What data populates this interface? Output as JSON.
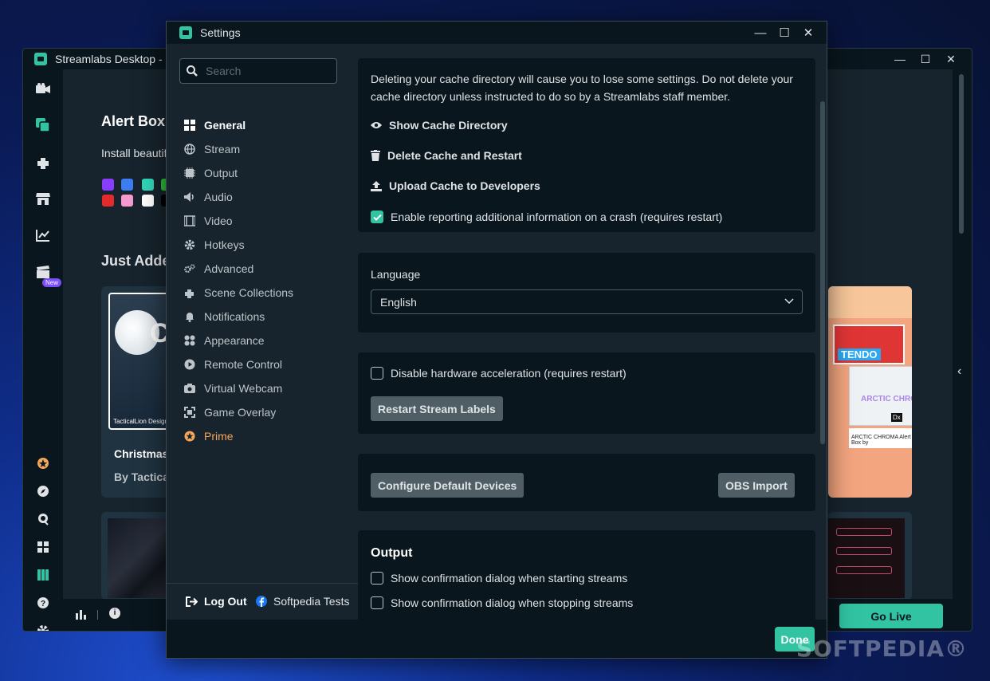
{
  "main_window": {
    "title": "Streamlabs Desktop - ",
    "new_badge": "New",
    "alert_box_title": "Alert Box",
    "alert_box_desc": "Install beautif",
    "swatches": [
      "#8b3dff",
      "#3d7df2",
      "#30d6b8",
      "#2ec43b",
      "#e32b2b",
      "#f59ad0",
      "#ffffff",
      "#000000"
    ],
    "just_added": "Just Adde",
    "card_left": {
      "name": "Christmas",
      "by": "By Tactical",
      "brand": "TacticalLion Designs",
      "letters": "CH"
    },
    "card_right": {
      "tendo": "TENDO",
      "arctic": "ARCTIC CHRO",
      "caption": "ARCTIC CHROMA Alert Box by",
      "badge": "Dx"
    },
    "go_live": "Go Live",
    "footer_info": "i"
  },
  "settings": {
    "title": "Settings",
    "search_placeholder": "Search",
    "nav": [
      {
        "label": "General",
        "icon": "grid-icon"
      },
      {
        "label": "Stream",
        "icon": "globe-icon"
      },
      {
        "label": "Output",
        "icon": "chip-icon"
      },
      {
        "label": "Audio",
        "icon": "speaker-icon"
      },
      {
        "label": "Video",
        "icon": "film-icon"
      },
      {
        "label": "Hotkeys",
        "icon": "gear-icon"
      },
      {
        "label": "Advanced",
        "icon": "gears-icon"
      },
      {
        "label": "Scene Collections",
        "icon": "puzzle-icon"
      },
      {
        "label": "Notifications",
        "icon": "bell-icon"
      },
      {
        "label": "Appearance",
        "icon": "apps-icon"
      },
      {
        "label": "Remote Control",
        "icon": "play-circle-icon"
      },
      {
        "label": "Virtual Webcam",
        "icon": "camera-icon"
      },
      {
        "label": "Game Overlay",
        "icon": "expand-icon"
      },
      {
        "label": "Prime",
        "icon": "prime-icon"
      }
    ],
    "logout": "Log Out",
    "account": "Softpedia Tests",
    "cache": {
      "warning": "Deleting your cache directory will cause you to lose some settings. Do not delete your cache directory unless instructed to do so by a Streamlabs staff member.",
      "show": "Show Cache Directory",
      "delete": "Delete Cache and Restart",
      "upload": "Upload Cache to Developers",
      "reporting": "Enable reporting additional information on a crash (requires restart)"
    },
    "language": {
      "label": "Language",
      "value": "English"
    },
    "hardware": {
      "disable_accel": "Disable hardware acceleration (requires restart)",
      "restart_labels": "Restart Stream Labels"
    },
    "devices": {
      "configure": "Configure Default Devices",
      "obs_import": "OBS Import"
    },
    "output": {
      "title": "Output",
      "confirm_start": "Show confirmation dialog when starting streams",
      "confirm_stop": "Show confirmation dialog when stopping streams"
    },
    "done": "Done"
  },
  "watermark": "SOFTPEDIA®",
  "colors": {
    "accent": "#31c3a2",
    "prime": "#f5a65b",
    "panel": "#09161d",
    "background": "#17242d"
  }
}
